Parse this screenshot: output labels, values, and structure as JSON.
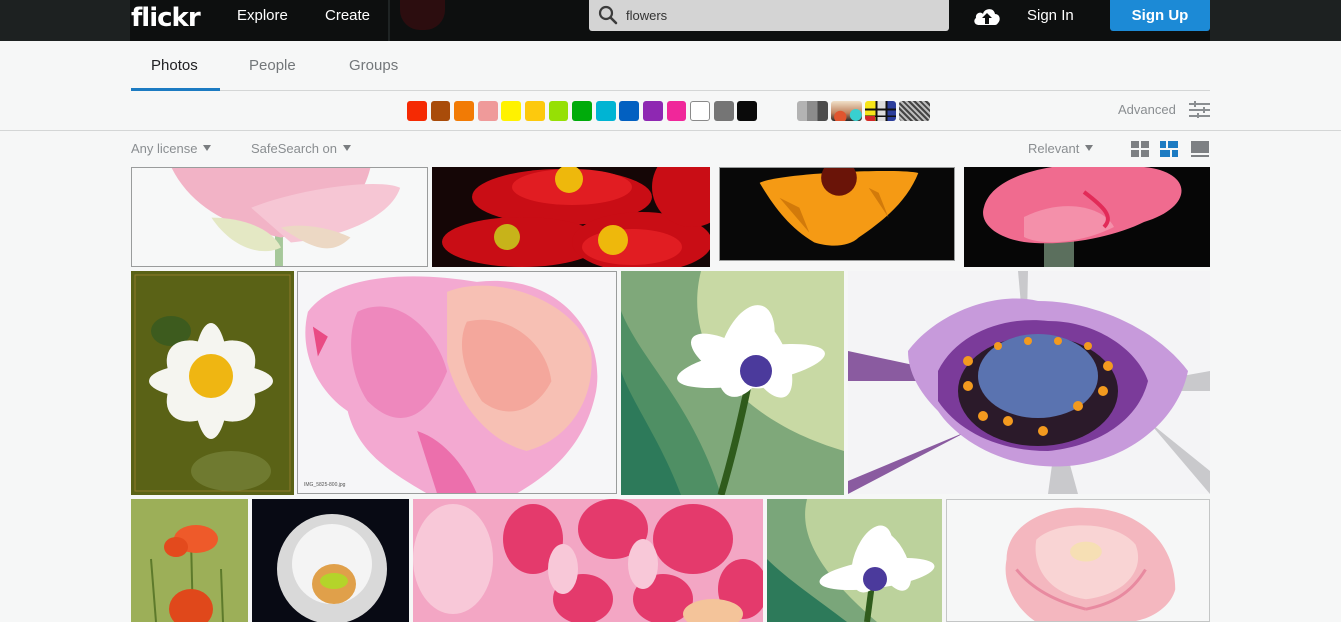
{
  "header": {
    "logo": "flickr",
    "nav": [
      {
        "label": "Explore"
      },
      {
        "label": "Create"
      }
    ],
    "search": {
      "value": "flowers",
      "placeholder": "",
      "icon": "search-icon"
    },
    "upload_icon": "cloud-upload-icon",
    "sign_in": "Sign In",
    "sign_up": "Sign Up",
    "colors": {
      "bar": "#0d0f0f",
      "signup_bg": "#1c8ad6"
    }
  },
  "tabs": [
    {
      "label": "Photos",
      "active": true
    },
    {
      "label": "People",
      "active": false
    },
    {
      "label": "Groups",
      "active": false
    }
  ],
  "color_filters": [
    {
      "name": "red",
      "hex": "#f52a03"
    },
    {
      "name": "dark-orange",
      "hex": "#a94c0a"
    },
    {
      "name": "orange",
      "hex": "#f27b05"
    },
    {
      "name": "pink",
      "hex": "#ef9a9a"
    },
    {
      "name": "lemon-yellow",
      "hex": "#fff200"
    },
    {
      "name": "school-bus-yellow",
      "hex": "#fdc90d"
    },
    {
      "name": "green",
      "hex": "#96e005"
    },
    {
      "name": "dark-lime-green",
      "hex": "#00ab0b"
    },
    {
      "name": "cyan",
      "hex": "#00b4d3"
    },
    {
      "name": "blue",
      "hex": "#0260c1"
    },
    {
      "name": "violet",
      "hex": "#8e28b2"
    },
    {
      "name": "magenta",
      "hex": "#f0279a"
    },
    {
      "name": "white",
      "hex": "#ffffff"
    },
    {
      "name": "gray",
      "hex": "#757575"
    },
    {
      "name": "black",
      "hex": "#0a0a0a"
    }
  ],
  "style_filters": [
    {
      "name": "black-and-white"
    },
    {
      "name": "shallow-depth-of-field"
    },
    {
      "name": "minimalism"
    },
    {
      "name": "patterns"
    }
  ],
  "advanced": {
    "label": "Advanced",
    "icon": "sliders-icon"
  },
  "filters": {
    "license": "Any license",
    "safesearch": "SafeSearch on",
    "sort": "Relevant"
  },
  "view_modes": [
    {
      "name": "grid-view",
      "active": false
    },
    {
      "name": "justified-view",
      "active": true
    },
    {
      "name": "large-view",
      "active": false
    }
  ],
  "photos": [
    {
      "subject": "pink lotus",
      "caption": ""
    },
    {
      "subject": "red daisies",
      "caption": ""
    },
    {
      "subject": "orange marigold",
      "caption": ""
    },
    {
      "subject": "pink carnation",
      "caption": ""
    },
    {
      "subject": "white daisy",
      "caption": ""
    },
    {
      "subject": "pink peony",
      "caption": "IMG_5825-800.jpg"
    },
    {
      "subject": "white osteospermum",
      "caption": ""
    },
    {
      "subject": "purple daisy closeup",
      "caption": ""
    },
    {
      "subject": "red poppies",
      "caption": ""
    },
    {
      "subject": "dandelion seed head",
      "caption": ""
    },
    {
      "subject": "pink dahlia closeup",
      "caption": ""
    },
    {
      "subject": "white osteospermum",
      "caption": ""
    },
    {
      "subject": "pink rose",
      "caption": ""
    }
  ]
}
